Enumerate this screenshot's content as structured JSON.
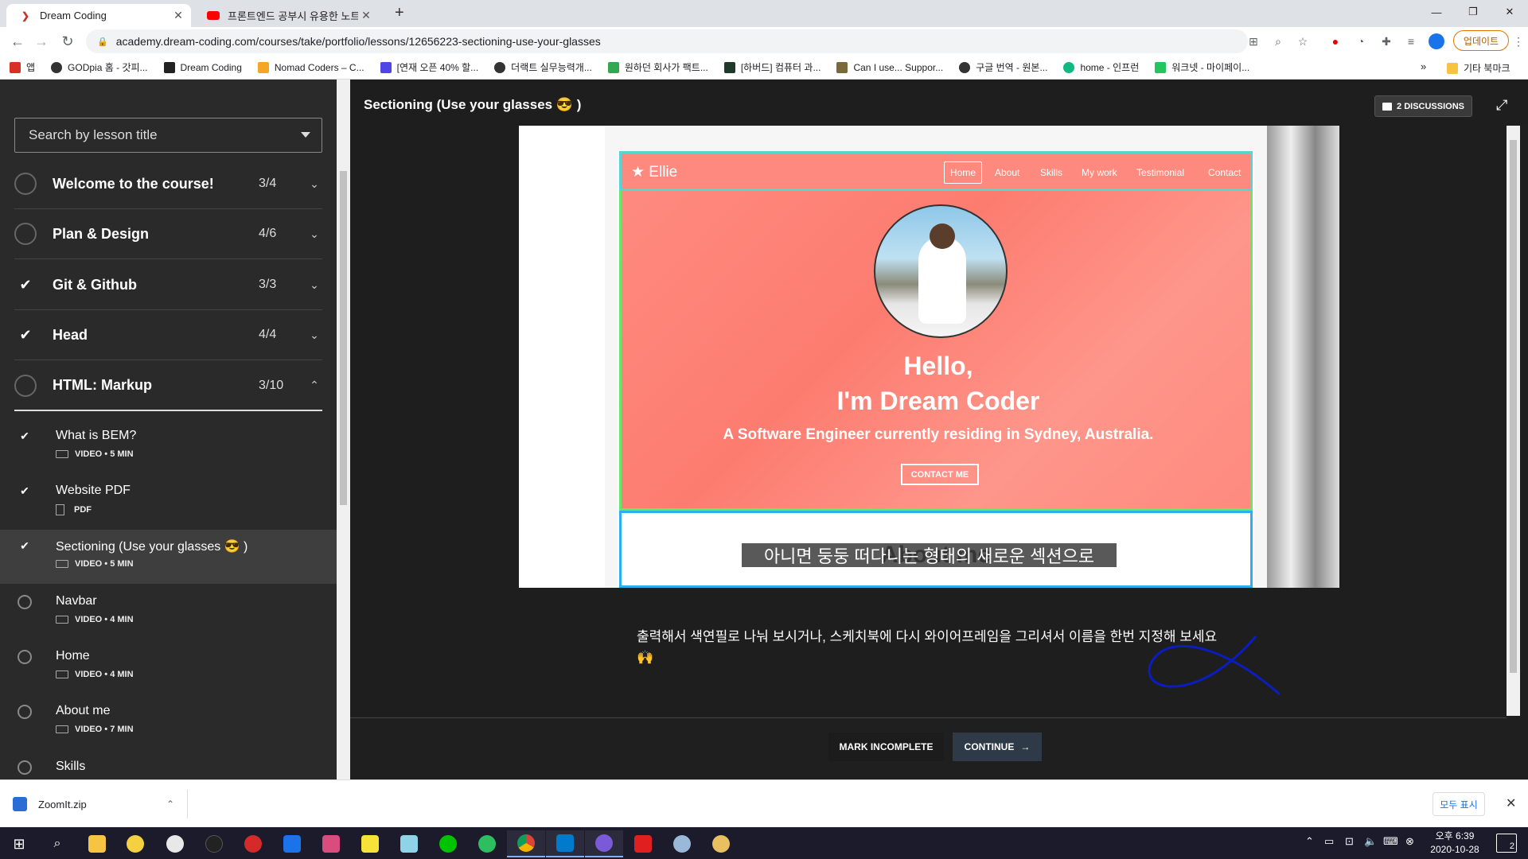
{
  "browser": {
    "tabs": [
      {
        "title": "Dream Coding",
        "icon": "dream-coding-logo",
        "active": true
      },
      {
        "title": "프론트엔드 공부시 유용한 노트",
        "icon": "youtube-logo",
        "active": false
      }
    ],
    "new_tab_symbol": "+",
    "window_controls": {
      "minimize": "—",
      "maximize": "❐",
      "close": "✕"
    },
    "url": "academy.dream-coding.com/courses/take/portfolio/lessons/12656223-sectioning-use-your-glasses",
    "update_button": "업데이트",
    "bookmarks": [
      {
        "label": "앱",
        "color": "#d93025"
      },
      {
        "label": "GODpia 홈 - 갓피...",
        "color": "#333333"
      },
      {
        "label": "Dream Coding",
        "color": "#222222"
      },
      {
        "label": "Nomad Coders – C...",
        "color": "#f5a623"
      },
      {
        "label": "[연재 오픈 40% 할...",
        "color": "#4f46e5"
      },
      {
        "label": "더랙트 실무능력개...",
        "color": "#333333"
      },
      {
        "label": "원하던 회사가 팩트...",
        "color": "#32a852"
      },
      {
        "label": "[하버드] 컴퓨터 과...",
        "color": "#1e3a2a"
      },
      {
        "label": "Can I use... Suppor...",
        "color": "#7a6a3a"
      },
      {
        "label": "구글 번역 - 원본...",
        "color": "#333333"
      },
      {
        "label": "home - 인프런",
        "color": "#10b981"
      },
      {
        "label": "워크넷 - 마이페이...",
        "color": "#22c55e"
      }
    ],
    "bookmarks_overflow": "»",
    "other_bookmarks": "기타 북마크"
  },
  "sidebar": {
    "search_placeholder": "Search by lesson title",
    "sections": [
      {
        "title": "Welcome to the course!",
        "count": "3/4",
        "done": false,
        "expanded": false
      },
      {
        "title": "Plan & Design",
        "count": "4/6",
        "done": false,
        "expanded": false
      },
      {
        "title": "Git & Github",
        "count": "3/3",
        "done": true,
        "expanded": false
      },
      {
        "title": "Head",
        "count": "4/4",
        "done": true,
        "expanded": false
      },
      {
        "title": "HTML: Markup",
        "count": "3/10",
        "done": false,
        "expanded": true
      }
    ],
    "lessons": [
      {
        "title": "What is BEM?",
        "meta": "VIDEO • 5 MIN",
        "done": true,
        "kind": "video"
      },
      {
        "title": "Website PDF",
        "meta": "PDF",
        "done": true,
        "kind": "pdf"
      },
      {
        "title": "Sectioning (Use your glasses 😎 )",
        "meta": "VIDEO • 5 MIN",
        "done": true,
        "kind": "video",
        "active": true
      },
      {
        "title": "Navbar",
        "meta": "VIDEO • 4 MIN",
        "done": false,
        "kind": "video"
      },
      {
        "title": "Home",
        "meta": "VIDEO • 4 MIN",
        "done": false,
        "kind": "video"
      },
      {
        "title": "About me",
        "meta": "VIDEO • 7 MIN",
        "done": false,
        "kind": "video"
      },
      {
        "title": "Skills",
        "meta": "",
        "done": false,
        "kind": "video"
      }
    ]
  },
  "content": {
    "lesson_title": "Sectioning (Use your glasses 😎 )",
    "discussions_label": "2 DISCUSSIONS",
    "video": {
      "site_logo": "★ Ellie",
      "nav": [
        "Home",
        "About",
        "Skills",
        "My work",
        "Testimonial",
        "Contact"
      ],
      "hero_hello": "Hello,",
      "hero_name": "I'm Dream Coder",
      "hero_desc": "A Software Engineer currently residing in Sydney, Australia.",
      "contact_button": "CONTACT ME",
      "about_title": "About me",
      "subtitle": "아니면 둥둥 떠다니는 형태의 새로운 섹션으로"
    },
    "note_text": "출력해서 색연필로 나눠 보시거나, 스케치북에 다시 와이어프레임을 그리셔서 이름을 한번 지정해 보세요 🙌",
    "mark_incomplete": "MARK INCOMPLETE",
    "continue": "CONTINUE"
  },
  "downloads": {
    "file": "ZoomIt.zip",
    "show_all": "모두 표시"
  },
  "taskbar": {
    "time": "오후 6:39",
    "date": "2020-10-28",
    "notifications": "2"
  }
}
